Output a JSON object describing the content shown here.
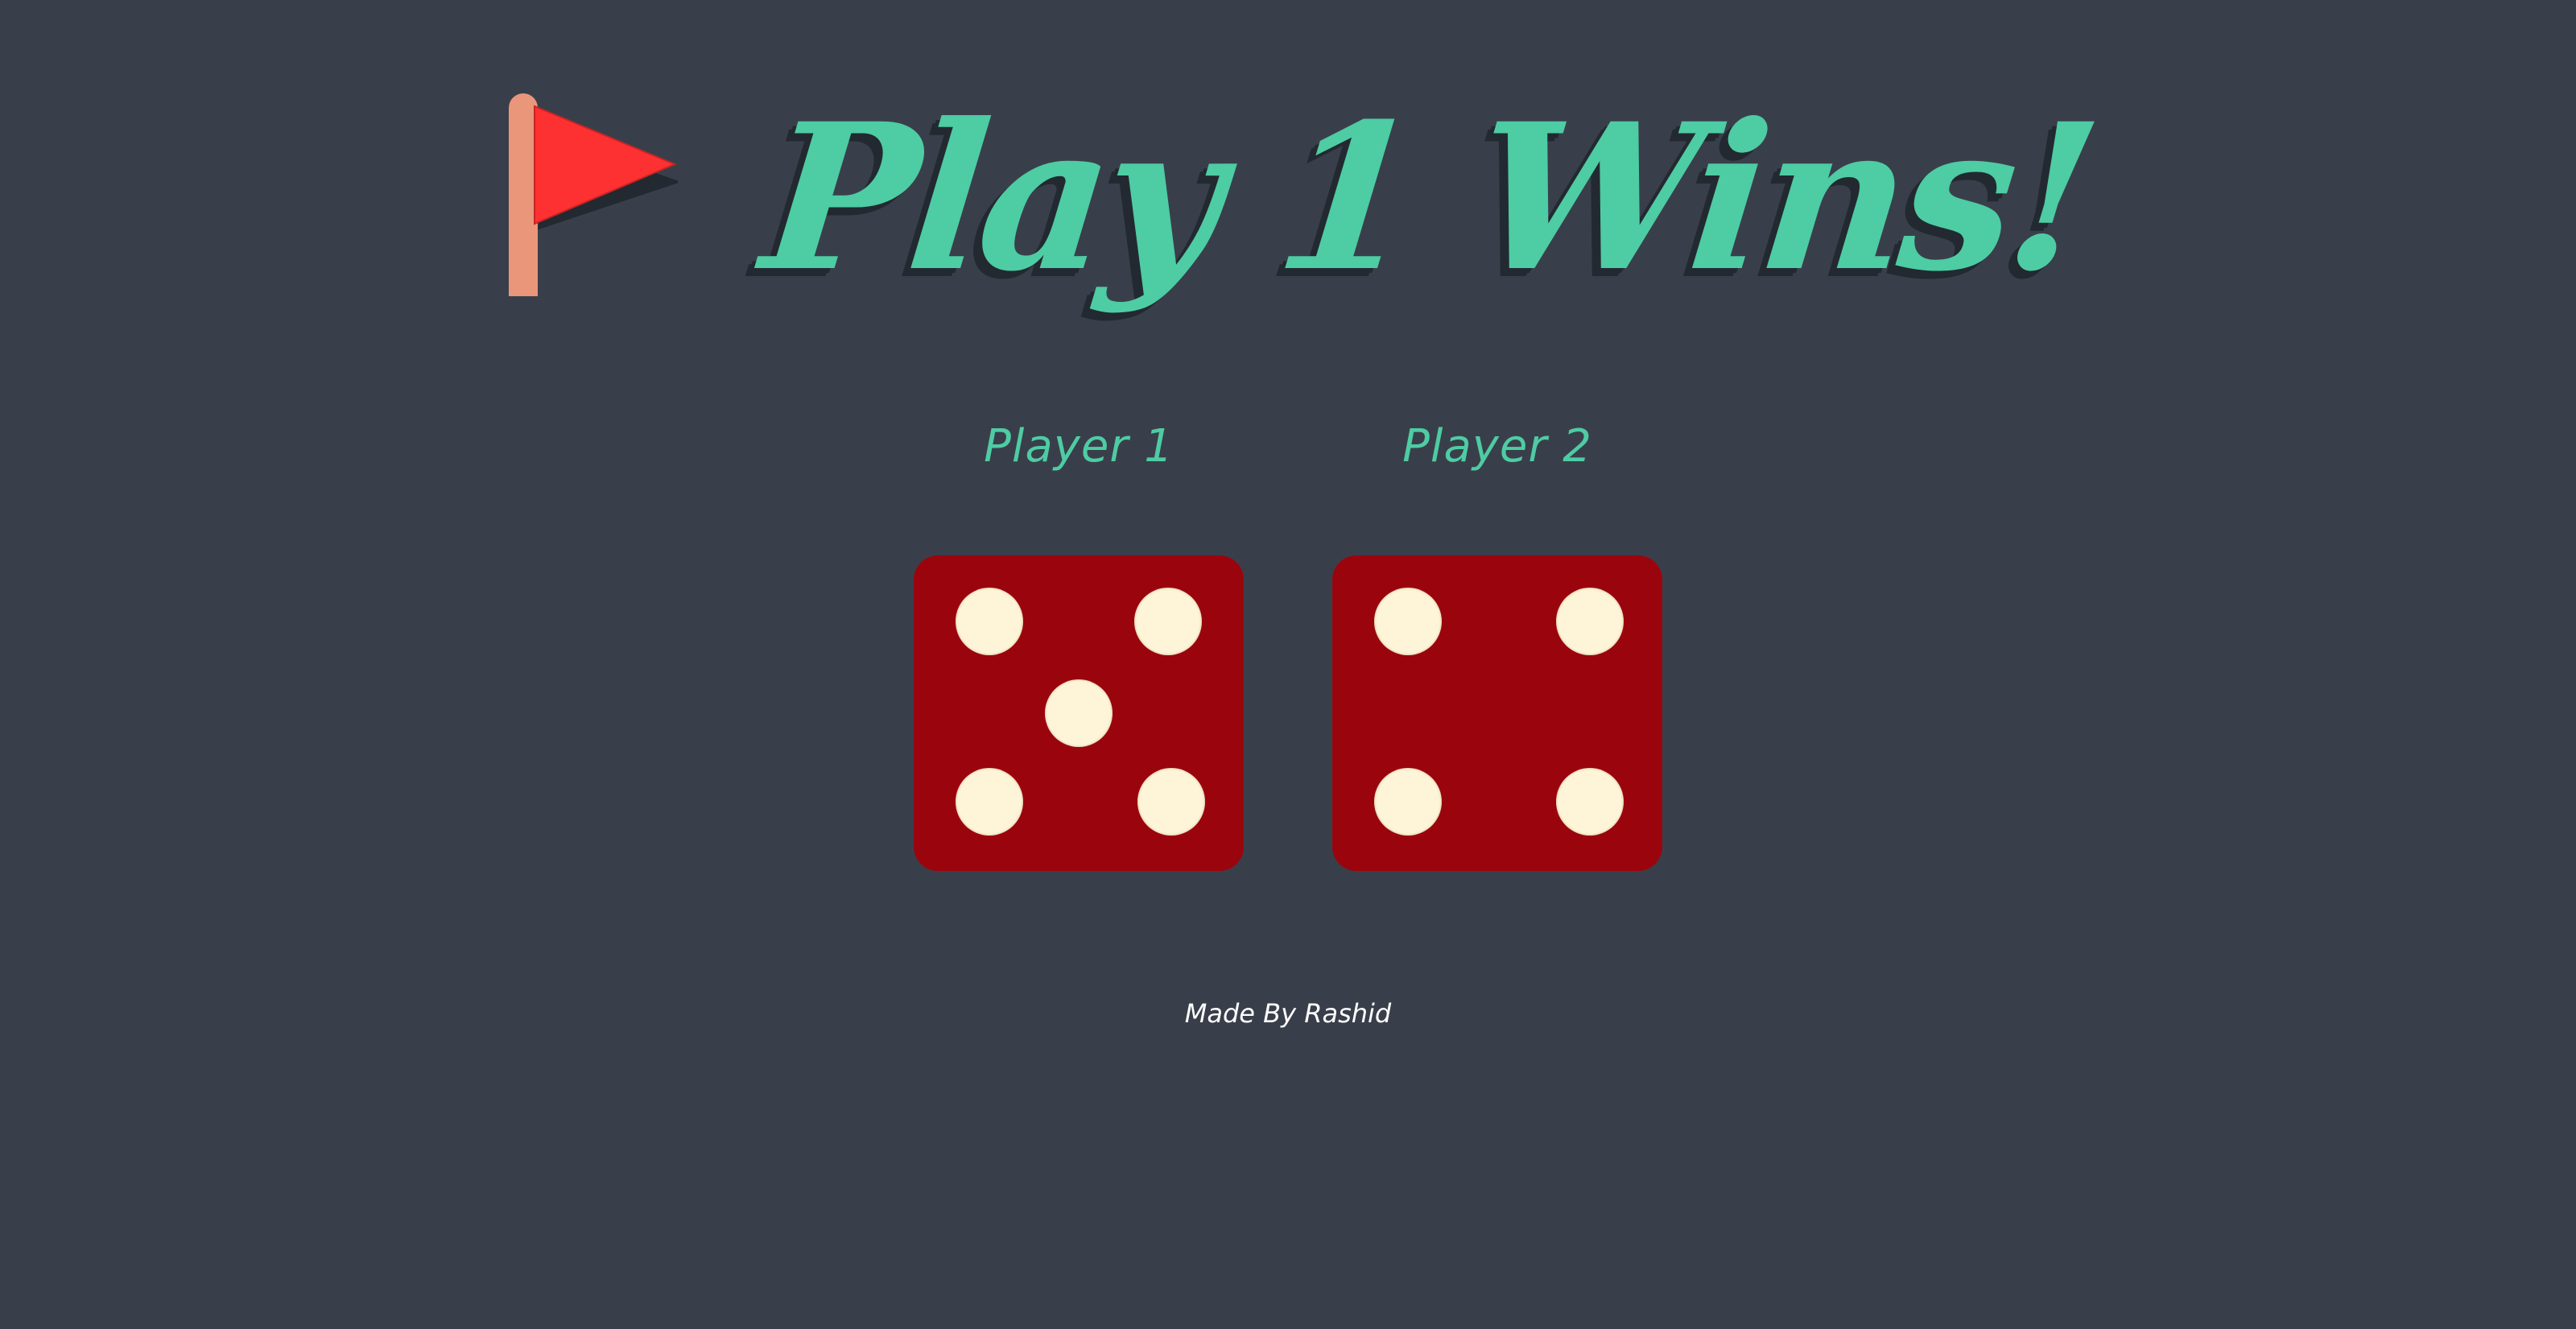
{
  "game": {
    "result_title": "Play 1 Wins!",
    "flag_icon": "red-flag-icon",
    "players": [
      {
        "label": "Player 1",
        "die_value": 5
      },
      {
        "label": "Player 2",
        "die_value": 4
      }
    ],
    "footer_credit": "Made By Rashid"
  },
  "colors": {
    "background": "#393f4a",
    "accent": "#4ecca3",
    "die": "#9a050d",
    "pip": "#fef5d9",
    "flag": "#fd3131",
    "flag_pole": "#e9967a"
  }
}
